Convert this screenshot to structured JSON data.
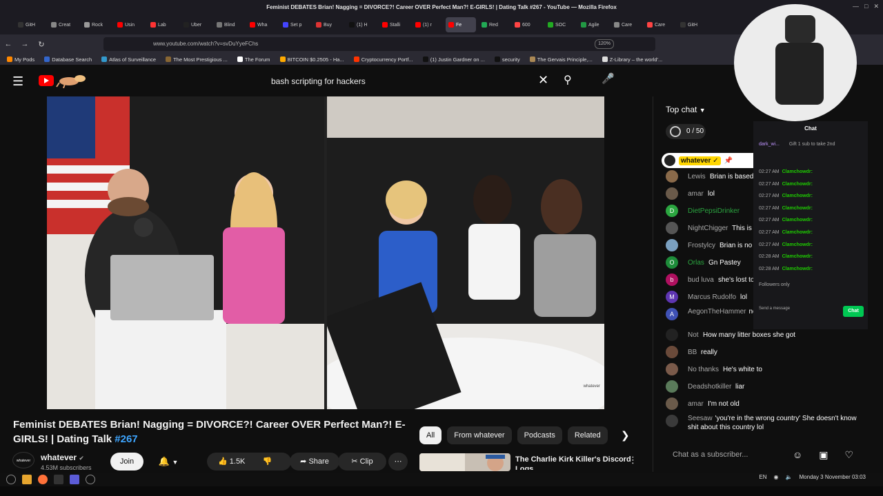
{
  "window": {
    "title": "Feminist DEBATES Brian! Nagging = DIVORCE?! Career OVER Perfect Man?! E-GIRLS! | Dating Talk #267 - YouTube — Mozilla Firefox"
  },
  "tabs": [
    {
      "label": "GitH",
      "color": "#333333"
    },
    {
      "label": "Creat",
      "color": "#888888"
    },
    {
      "label": "Rock",
      "color": "#999999"
    },
    {
      "label": "Usin",
      "color": "#ff0000"
    },
    {
      "label": "Lab",
      "color": "#ff3333"
    },
    {
      "label": "Uber",
      "color": "#222222"
    },
    {
      "label": "Blind",
      "color": "#777777"
    },
    {
      "label": "Wha",
      "color": "#ff0000"
    },
    {
      "label": "Set p",
      "color": "#4444ff"
    },
    {
      "label": "Buy",
      "color": "#dd3333"
    },
    {
      "label": "(1) H",
      "color": "#111111"
    },
    {
      "label": "Stalli",
      "color": "#ff0000"
    },
    {
      "label": "(1) r",
      "color": "#ff0000"
    },
    {
      "label": "Fe",
      "color": "#ff0000",
      "active": true
    },
    {
      "label": "Red",
      "color": "#22aa55"
    },
    {
      "label": "600",
      "color": "#ff4444"
    },
    {
      "label": "SOC",
      "color": "#22aa22"
    },
    {
      "label": "Agile",
      "color": "#229944"
    },
    {
      "label": "Care",
      "color": "#888888"
    },
    {
      "label": "Care",
      "color": "#ff4444"
    },
    {
      "label": "GitH",
      "color": "#333333"
    }
  ],
  "navbar": {
    "url": "www.youtube.com/watch?v=svDuYyeFChs",
    "zoom": "120%"
  },
  "bookmarks": [
    {
      "label": "My Pods",
      "color": "#ff8800"
    },
    {
      "label": "Database Search",
      "color": "#3366cc"
    },
    {
      "label": "Atlas of Surveillance",
      "color": "#3399cc"
    },
    {
      "label": "The Most Prestigious ...",
      "color": "#886633"
    },
    {
      "label": "The Forum",
      "color": "#ffffff"
    },
    {
      "label": "BITCOIN $0.2505 - Ha...",
      "color": "#ffaa00"
    },
    {
      "label": "Cryptocurrency Portf...",
      "color": "#ff3300"
    },
    {
      "label": "(1) Justin Gardner on ...",
      "color": "#111111"
    },
    {
      "label": "security",
      "color": "#111111"
    },
    {
      "label": "The Gervais Principle,...",
      "color": "#aa8855"
    },
    {
      "label": "Z-Library – the world'...",
      "color": "#dddddd"
    }
  ],
  "search": {
    "query": "bash scripting for hackers"
  },
  "video": {
    "watermark": "whatever",
    "title": "Feminist DEBATES Brian! Nagging = DIVORCE?! Career OVER Perfect Man?! E-GIRLS! | Dating Talk ",
    "hashtag": "#267",
    "channel": "whatever",
    "channel_avatar_text": "whatever",
    "subscribers": "4.53M subscribers",
    "join": "Join",
    "likes": "1.5K",
    "share": "Share",
    "clip": "Clip"
  },
  "chips": [
    "All",
    "From whatever",
    "Podcasts",
    "Related"
  ],
  "recommended": {
    "title": "The Charlie Kirk Killer's Discord Logs"
  },
  "chat": {
    "mode": "Top chat",
    "points": "0 / 50",
    "pinned_name": "whatever ✓",
    "messages": [
      {
        "author": "Lewis",
        "text": "Brian is based",
        "initial": "",
        "color": "#8a6a4a"
      },
      {
        "author": "amar",
        "text": "lol",
        "initial": "",
        "color": "#6a5a4a"
      },
      {
        "author": "DietPepsiDrinker",
        "text": "",
        "initial": "D",
        "color": "#2ba640",
        "green": true
      },
      {
        "author": "NightChigger",
        "text": "This is",
        "initial": "",
        "color": "#555555"
      },
      {
        "author": "Frostylcy",
        "text": "Brian is no",
        "initial": "",
        "color": "#7aa0c0"
      },
      {
        "author": "Orlas",
        "text": "Gn Pastey",
        "initial": "O",
        "color": "#1e8c3a",
        "green": true
      },
      {
        "author": "bud luva",
        "text": "she's lost to",
        "initial": "b",
        "color": "#b01060"
      },
      {
        "author": "Marcus Rudolfo",
        "text": "lol",
        "initial": "M",
        "color": "#5e35b1"
      },
      {
        "author": "AegonTheHammer",
        "text": "not expected, that's w",
        "initial": "A",
        "color": "#3f51b5",
        "two": true
      },
      {
        "author": "Not",
        "text": "How many litter boxes she got",
        "initial": "",
        "color": "#222222"
      },
      {
        "author": "BB",
        "text": "really",
        "initial": "",
        "color": "#6a4a3a"
      },
      {
        "author": "No thanks",
        "text": "He's white to",
        "initial": "",
        "color": "#7a5a4a"
      },
      {
        "author": "Deadshotkiller",
        "text": "liar",
        "initial": "",
        "color": "#5a7a5a"
      },
      {
        "author": "amar",
        "text": "I'm not old",
        "initial": "",
        "color": "#6a5a4a"
      },
      {
        "author": "Seesaw",
        "text": "'you're in the wrong country' She doesn't know shit about this country lol",
        "initial": "",
        "color": "#3a3a3a",
        "two": true
      }
    ],
    "input_placeholder": "Chat as a subscriber..."
  },
  "overlay": {
    "title": "Chat",
    "top_user": "dark_wi...",
    "gift_note": "Gift 1 sub to take 2nd",
    "lines": [
      {
        "time": "02:27 AM",
        "user": "Clamchowdr:"
      },
      {
        "time": "02:27 AM",
        "user": "Clamchowdr:"
      },
      {
        "time": "02:27 AM",
        "user": "Clamchowdr:"
      },
      {
        "time": "02:27 AM",
        "user": "Clamchowdr:"
      },
      {
        "time": "02:27 AM",
        "user": "Clamchowdr:"
      },
      {
        "time": "02:27 AM",
        "user": "Clamchowdr:"
      },
      {
        "time": "02:27 AM",
        "user": "Clamchowdr:"
      },
      {
        "time": "02:28 AM",
        "user": "Clamchowdr:"
      },
      {
        "time": "02:28 AM",
        "user": "Clamchowdr:"
      }
    ],
    "followers_only": "Followers only",
    "input_placeholder": "Send a message",
    "chat_button": "Chat"
  },
  "taskbar": {
    "lang": "EN",
    "clock": "Monday  3 November 03:03"
  }
}
